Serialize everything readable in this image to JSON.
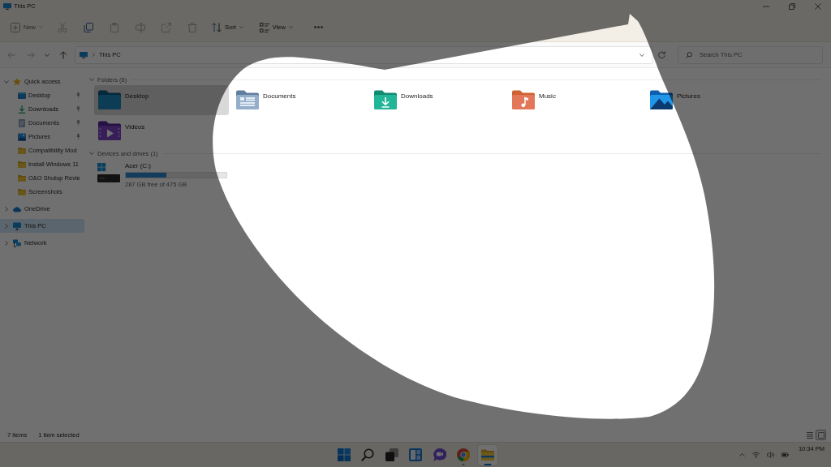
{
  "window": {
    "title": "This PC"
  },
  "toolbar": {
    "new": {
      "label": "New",
      "disabled": true
    },
    "actions": [
      {
        "disabled": true
      },
      {
        "disabled": false
      },
      {
        "disabled": true
      },
      {
        "disabled": true
      },
      {
        "disabled": true
      },
      {
        "disabled": true
      }
    ],
    "sort": {
      "label": "Sort"
    },
    "view": {
      "label": "View"
    }
  },
  "navigation": {
    "buttons": [
      {
        "disabled": true
      },
      {
        "disabled": true
      },
      {
        "disabled": false
      }
    ],
    "address": "This PC",
    "search": {
      "placeholder": "Search This PC"
    }
  },
  "sidebar": {
    "items": [
      {
        "label": "Quick access",
        "kind": "quick-access",
        "expanded": true,
        "selected": false,
        "children": [
          {
            "label": "Desktop",
            "kind": "desktop",
            "pinned": true,
            "selected": false
          },
          {
            "label": "Downloads",
            "kind": "downloads",
            "pinned": true,
            "selected": false
          },
          {
            "label": "Documents",
            "kind": "documents",
            "pinned": true,
            "selected": false
          },
          {
            "label": "Pictures",
            "kind": "pictures",
            "pinned": true,
            "selected": false
          },
          {
            "label": "Compatibility Mod",
            "kind": "folder",
            "pinned": false,
            "selected": false
          },
          {
            "label": "Install Windows 11",
            "kind": "folder",
            "pinned": false,
            "selected": false
          },
          {
            "label": "O&O Shutup Revie",
            "kind": "folder",
            "pinned": false,
            "selected": false
          },
          {
            "label": "Screenshots",
            "kind": "folder",
            "pinned": false,
            "selected": false
          }
        ]
      },
      {
        "label": "OneDrive",
        "kind": "cloud",
        "expanded": false,
        "selected": false
      },
      {
        "label": "This PC",
        "kind": "pc",
        "expanded": false,
        "selected": true
      },
      {
        "label": "Network",
        "kind": "network",
        "expanded": false,
        "selected": false
      }
    ]
  },
  "sections": [
    {
      "title": "Folders (6)",
      "expanded": true,
      "items": [
        {
          "label": "Desktop",
          "kind": "desktop",
          "selected": true
        },
        {
          "label": "Documents",
          "kind": "documents",
          "selected": false
        },
        {
          "label": "Downloads",
          "kind": "downloads",
          "selected": false
        },
        {
          "label": "Music",
          "kind": "music",
          "selected": false
        },
        {
          "label": "Pictures",
          "kind": "pictures",
          "selected": false
        },
        {
          "label": "Videos",
          "kind": "videos",
          "selected": false
        }
      ]
    },
    {
      "title": "Devices and drives (1)",
      "expanded": true,
      "items": [
        {
          "label": "Acer (C:)",
          "kind": "drive",
          "level": 0.4,
          "detail": "287 GB free of 475 GB",
          "selected": false
        }
      ]
    }
  ],
  "status_bar": {
    "count": "7 items",
    "selection": "1 item selected",
    "views": [
      {
        "kind": "details",
        "selected": false
      },
      {
        "kind": "tiles",
        "selected": true
      }
    ]
  },
  "taskbar": {
    "apps": [
      {
        "kind": "start",
        "running": false,
        "active": false
      },
      {
        "kind": "search",
        "running": false,
        "active": false
      },
      {
        "kind": "task-view",
        "running": false,
        "active": false
      },
      {
        "kind": "widgets",
        "running": false,
        "active": false
      },
      {
        "kind": "chat",
        "running": false,
        "active": false
      },
      {
        "kind": "browser",
        "running": true,
        "active": false
      },
      {
        "kind": "file-explorer",
        "running": true,
        "active": true
      }
    ],
    "time": "10:34 PM"
  }
}
